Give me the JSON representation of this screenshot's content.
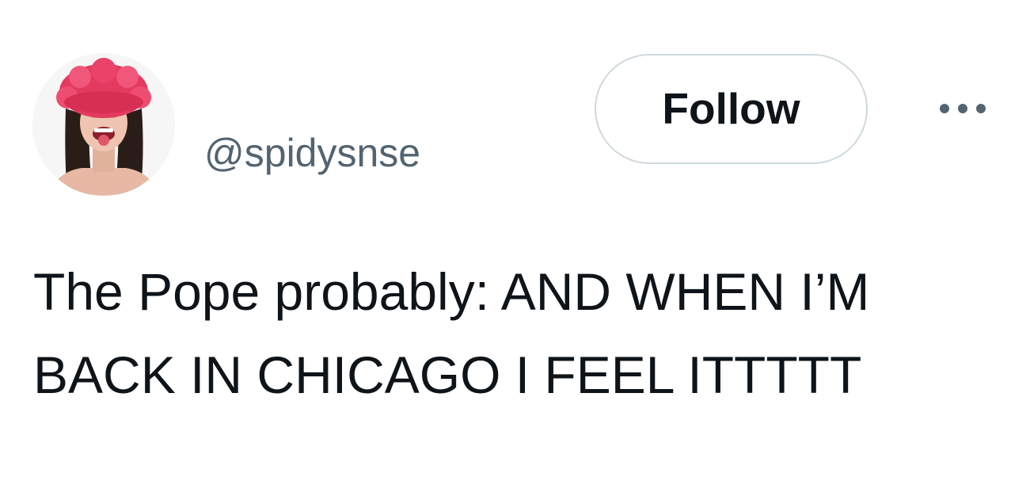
{
  "tweet": {
    "author_handle": "@spidysnse",
    "follow_label": "Follow",
    "more_icon": "more-horizontal-icon",
    "text": "The Pope probably: AND WHEN I’M BACK IN CHICAGO I FEEL ITTTTT"
  },
  "colors": {
    "text_primary": "#0f1419",
    "text_secondary": "#536471",
    "button_border": "#cfd9de",
    "hat": "#e33a5f"
  }
}
